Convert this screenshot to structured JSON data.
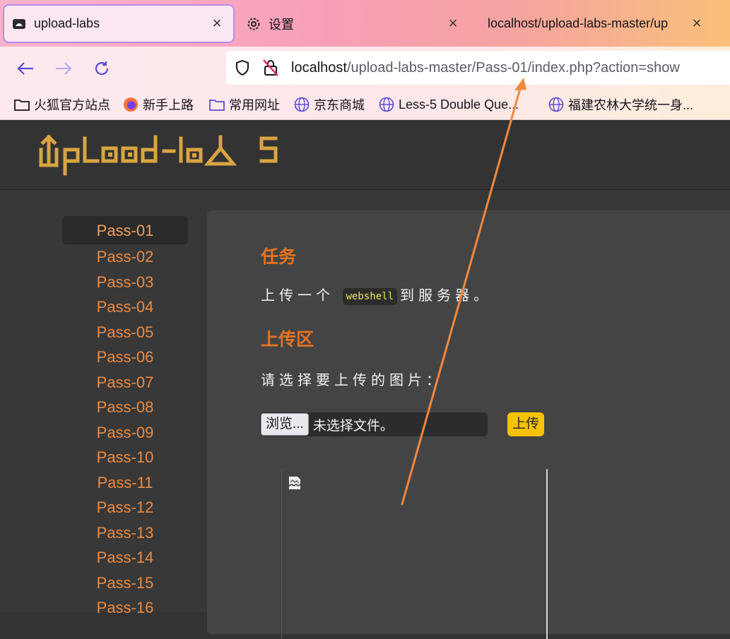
{
  "browser": {
    "tabs": [
      {
        "title": "upload-labs",
        "icon": "site-favicon"
      },
      {
        "title": "设置",
        "icon": "gear-icon"
      },
      {
        "title": "localhost/upload-labs-master/up",
        "icon": ""
      }
    ],
    "url": {
      "host": "localhost",
      "path": "/upload-labs-master/Pass-01/index.php?action=show"
    },
    "bookmarks": [
      {
        "label": "火狐官方站点",
        "icon": "folder-icon"
      },
      {
        "label": "新手上路",
        "icon": "firefox-icon"
      },
      {
        "label": "常用网址",
        "icon": "folder-icon"
      },
      {
        "label": "京东商城",
        "icon": "globe-icon"
      },
      {
        "label": "Less-5 Double Que...",
        "icon": "globe-icon"
      },
      {
        "label": "福建农林大学统一身...",
        "icon": "globe-icon"
      }
    ]
  },
  "site": {
    "logo_text": "UpLoad-labs",
    "nav": [
      "Pass-01",
      "Pass-02",
      "Pass-03",
      "Pass-04",
      "Pass-05",
      "Pass-06",
      "Pass-07",
      "Pass-08",
      "Pass-09",
      "Pass-10",
      "Pass-11",
      "Pass-12",
      "Pass-13",
      "Pass-14",
      "Pass-15",
      "Pass-16"
    ],
    "active_nav": "Pass-01"
  },
  "task": {
    "heading": "任务",
    "text_before": "上传一个",
    "code": "webshell",
    "text_after": "到服务器。"
  },
  "upload": {
    "heading": "上传区",
    "prompt": "请选择要上传的图片：",
    "browse_label": "浏览...",
    "file_status": "未选择文件。",
    "submit_label": "上传"
  },
  "colors": {
    "accent": "#e8731f",
    "nav_link": "#f08a3c",
    "submit": "#f7c300",
    "annotation_arrow": "#f0883e"
  }
}
